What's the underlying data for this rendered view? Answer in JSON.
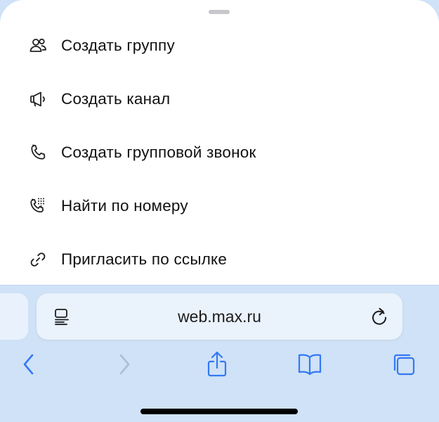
{
  "menu": {
    "items": [
      {
        "label": "Создать группу",
        "icon": "group-icon"
      },
      {
        "label": "Создать канал",
        "icon": "megaphone-icon"
      },
      {
        "label": "Создать групповой звонок",
        "icon": "phone-icon"
      },
      {
        "label": "Найти по номеру",
        "icon": "dialpad-phone-icon"
      },
      {
        "label": "Пригласить по ссылке",
        "icon": "link-icon"
      }
    ]
  },
  "browser": {
    "url": "web.max.ru",
    "accent_color": "#3478f6",
    "disabled_color": "#a9bfd8"
  }
}
